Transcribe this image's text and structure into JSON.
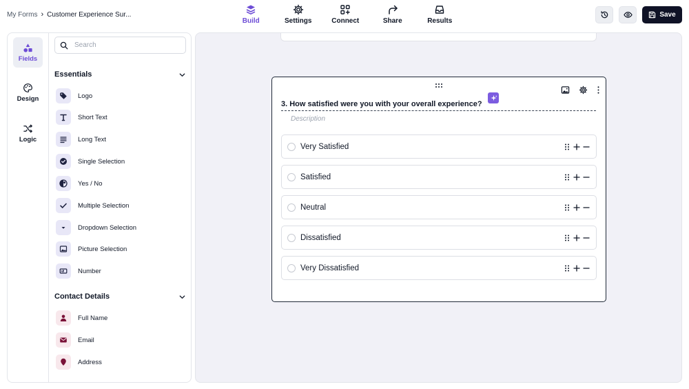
{
  "breadcrumb": {
    "root": "My Forms",
    "separator": "›",
    "current": "Customer Experience Sur..."
  },
  "nav_tabs": [
    {
      "label": "Build",
      "icon": "layers-icon",
      "active": true
    },
    {
      "label": "Settings",
      "icon": "gear-icon",
      "active": false
    },
    {
      "label": "Connect",
      "icon": "connect-icon",
      "active": false
    },
    {
      "label": "Share",
      "icon": "share-arrow-icon",
      "active": false
    },
    {
      "label": "Results",
      "icon": "inbox-icon",
      "active": false
    }
  ],
  "actions": {
    "history_icon": "history-icon",
    "preview_icon": "eye-icon",
    "save_label": "Save"
  },
  "rail": [
    {
      "label": "Fields",
      "icon": "shapes-icon",
      "active": true
    },
    {
      "label": "Design",
      "icon": "palette-icon",
      "active": false
    },
    {
      "label": "Logic",
      "icon": "shuffle-icon",
      "active": false
    }
  ],
  "search": {
    "placeholder": "Search",
    "value": ""
  },
  "sections": {
    "essentials": {
      "title": "Essentials",
      "items": [
        {
          "label": "Logo",
          "icon": "tag-icon"
        },
        {
          "label": "Short Text",
          "icon": "text-t-icon"
        },
        {
          "label": "Long Text",
          "icon": "paragraph-lines-icon"
        },
        {
          "label": "Single Selection",
          "icon": "check-circle-icon"
        },
        {
          "label": "Yes / No",
          "icon": "yes-no-toggle-icon"
        },
        {
          "label": "Multiple Selection",
          "icon": "checkmark-icon"
        },
        {
          "label": "Dropdown Selection",
          "icon": "dropdown-caret-icon"
        },
        {
          "label": "Picture Selection",
          "icon": "picture-icon"
        },
        {
          "label": "Number",
          "icon": "number-box-icon"
        }
      ]
    },
    "contact": {
      "title": "Contact Details",
      "items": [
        {
          "label": "Full Name",
          "icon": "person-icon"
        },
        {
          "label": "Email",
          "icon": "envelope-icon"
        },
        {
          "label": "Address",
          "icon": "location-pin-icon"
        }
      ]
    }
  },
  "question": {
    "title": "3. How satisfied were you with your overall experience?",
    "description_placeholder": "Description",
    "options": [
      {
        "label": "Very Satisfied"
      },
      {
        "label": "Satisfied"
      },
      {
        "label": "Neutral"
      },
      {
        "label": "Dissatisfied"
      },
      {
        "label": "Very Dissatisfied"
      }
    ]
  },
  "colors": {
    "accent": "#6d4cd6",
    "save_bg": "#0f1226",
    "canvas_bg": "#f1f1f7",
    "contact_icon": "#7a1238"
  }
}
